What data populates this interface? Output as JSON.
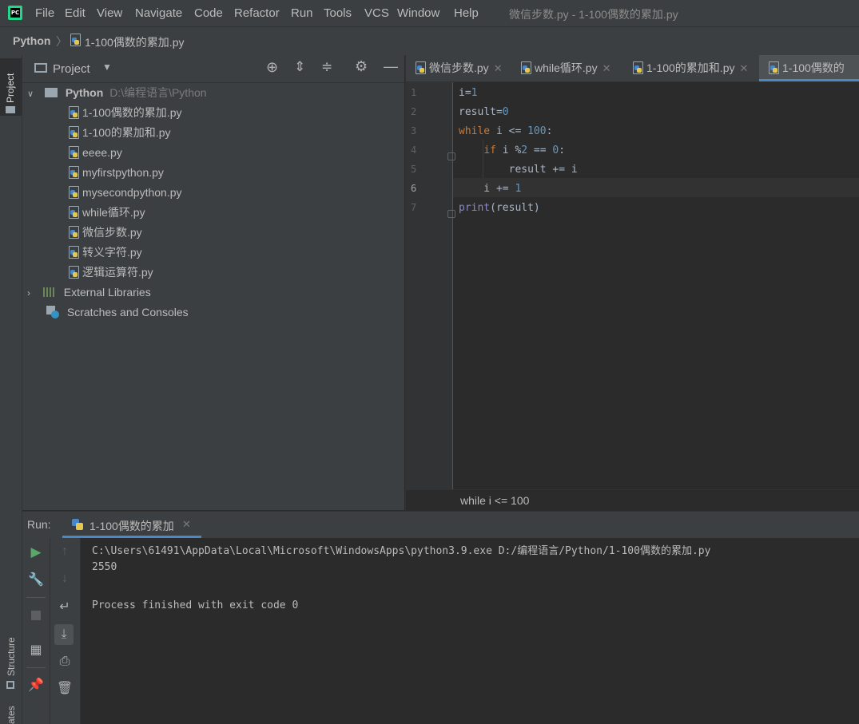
{
  "menubar": {
    "items": [
      "File",
      "Edit",
      "View",
      "Navigate",
      "Code",
      "Refactor",
      "Run",
      "Tools",
      "VCS",
      "Window",
      "Help"
    ],
    "window_title": "微信步数.py - 1-100偶数的累加.py",
    "logo_text": "PC"
  },
  "breadcrumb": {
    "project": "Python",
    "file": "1-100偶数的累加.py"
  },
  "left_strip": {
    "top_label": "Project",
    "bottom_label": "Structure",
    "bottom2_label": "ates"
  },
  "project_panel": {
    "title": "Project",
    "root": {
      "name": "Python",
      "path": "D:\\编程语言\\Python"
    },
    "files": [
      "1-100偶数的累加.py",
      "1-100的累加和.py",
      "eeee.py",
      "myfirstpython.py",
      "mysecondpython.py",
      "while循环.py",
      "微信步数.py",
      "转义字符.py",
      "逻辑运算符.py"
    ],
    "external_libraries": "External Libraries",
    "scratches": "Scratches and Consoles"
  },
  "editor": {
    "tabs": [
      {
        "label": "微信步数.py",
        "active": false
      },
      {
        "label": "while循环.py",
        "active": false
      },
      {
        "label": "1-100的累加和.py",
        "active": false
      },
      {
        "label": "1-100偶数的",
        "active": true
      }
    ],
    "line_numbers": [
      "1",
      "2",
      "3",
      "4",
      "5",
      "6",
      "7"
    ],
    "footer_breadcrumb": "while i <= 100",
    "colors": {
      "keyword": "#cc7832",
      "number": "#6897bb",
      "builtin": "#8888c6",
      "text": "#a9b7c6"
    }
  },
  "run": {
    "label": "Run:",
    "tab_label": "1-100偶数的累加",
    "console": [
      "C:\\Users\\61491\\AppData\\Local\\Microsoft\\WindowsApps\\python3.9.exe D:/编程语言/Python/1-100偶数的累加.py",
      "2550",
      "",
      "Process finished with exit code 0"
    ]
  }
}
